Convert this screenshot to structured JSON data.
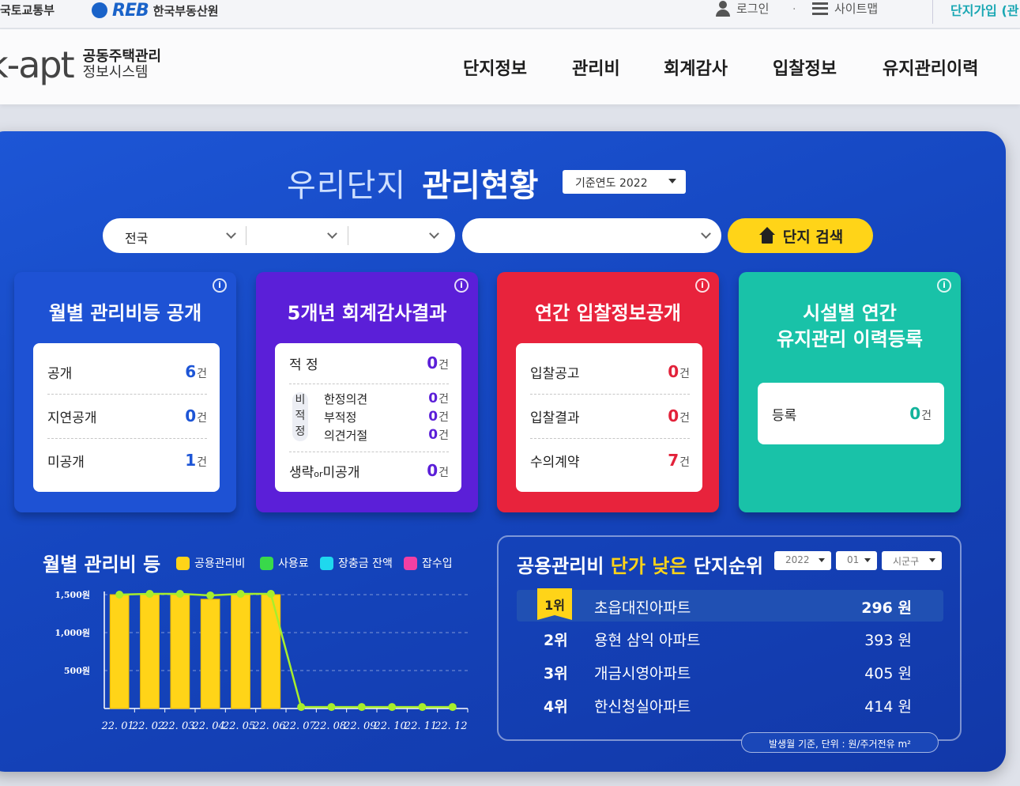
{
  "topbar": {
    "ministry": "국토교통부",
    "reb_logo": "REB",
    "reb_name": "한국부동산원",
    "login": "로그인",
    "separator": "·",
    "sitemap": "사이트맵",
    "join": "단지가입 (관"
  },
  "brand": {
    "logo": "k-apt",
    "line1": "공동주택관리",
    "line2": "정보시스템"
  },
  "nav": [
    "단지정보",
    "관리비",
    "회계감사",
    "입찰정보",
    "유지관리이력"
  ],
  "panel": {
    "title_light": "우리단지",
    "title_bold": "관리현황",
    "year_select": "기준연도 2022",
    "region_select": "전국",
    "search_button": "단지 검색"
  },
  "cards": [
    {
      "title": "월별 관리비등 공개",
      "color": "#1e52d4",
      "rows": [
        {
          "label": "공개",
          "value": "6",
          "unit": "건"
        },
        {
          "label": "지연공개",
          "value": "0",
          "unit": "건"
        },
        {
          "label": "미공개",
          "value": "1",
          "unit": "건"
        }
      ],
      "value_color": "#1d55d6"
    },
    {
      "title": "5개년 회계감사결과",
      "color": "#5b1fd8",
      "row_top": {
        "label": "적 정",
        "value": "0",
        "unit": "건"
      },
      "side_label": [
        "비",
        "적",
        "정"
      ],
      "sub_rows": [
        {
          "label": "한정의견",
          "value": "0",
          "unit": "건"
        },
        {
          "label": "부적정",
          "value": "0",
          "unit": "건"
        },
        {
          "label": "의견거절",
          "value": "0",
          "unit": "건"
        }
      ],
      "row_bottom": {
        "label_a": "생략",
        "label_or": "or",
        "label_b": "미공개",
        "value": "0",
        "unit": "건"
      },
      "value_color": "#5b1fd8"
    },
    {
      "title": "연간 입찰정보공개",
      "color": "#e8233c",
      "rows": [
        {
          "label": "입찰공고",
          "value": "0",
          "unit": "건"
        },
        {
          "label": "입찰결과",
          "value": "0",
          "unit": "건"
        },
        {
          "label": "수의계약",
          "value": "7",
          "unit": "건"
        }
      ],
      "value_color": "#e2223a"
    },
    {
      "title_l1": "시설별 연간",
      "title_l2": "유지관리 이력등록",
      "color": "#19c2a8",
      "rows": [
        {
          "label": "등록",
          "value": "0",
          "unit": "건"
        }
      ],
      "value_color": "#12b39b"
    }
  ],
  "chart_title": "월별 관리비 등",
  "legend": [
    {
      "name": "공용관리비",
      "color": "#ffd418"
    },
    {
      "name": "사용료",
      "color": "#39d94a"
    },
    {
      "name": "장충금 잔액",
      "color": "#1fd8ee"
    },
    {
      "name": "잡수입",
      "color": "#f23fa3"
    }
  ],
  "chart_data": {
    "type": "bar",
    "categories": [
      "22. 01",
      "22. 02",
      "22. 03",
      "22. 04",
      "22. 05",
      "22. 06",
      "22. 07",
      "22. 08",
      "22. 09",
      "22. 10",
      "22. 11",
      "22. 12"
    ],
    "ytick_labels": [
      "1,500원",
      "1,000원",
      "500원"
    ],
    "ytick_values": [
      1500,
      1000,
      500
    ],
    "ylim": [
      0,
      1500
    ],
    "series": [
      {
        "name": "공용관리비",
        "type": "bar",
        "color": "#ffd418",
        "values": [
          1500,
          1500,
          1500,
          1440,
          1500,
          1500,
          0,
          0,
          0,
          0,
          0,
          0
        ]
      },
      {
        "name": "사용료",
        "type": "line",
        "color": "#a7ee2c",
        "values": [
          1500,
          1510,
          1510,
          1490,
          1510,
          1510,
          20,
          20,
          20,
          20,
          20,
          20
        ]
      }
    ],
    "grid": true
  },
  "ranking": {
    "title_a": "공용관리비 ",
    "title_hl": "단가 낮은",
    "title_b": " 단지순위",
    "selects": [
      "2022",
      "01",
      "시군구"
    ],
    "items": [
      {
        "rank": "1위",
        "name": "초읍대진아파트",
        "price": "296 원"
      },
      {
        "rank": "2위",
        "name": "용현 삼익 아파트",
        "price": "393 원"
      },
      {
        "rank": "3위",
        "name": "개금시영아파트",
        "price": "405 원"
      },
      {
        "rank": "4위",
        "name": "한신청실아파트",
        "price": "414 원"
      }
    ],
    "note": "발생월 기준, 단위 : 원/주거전유 m²"
  }
}
